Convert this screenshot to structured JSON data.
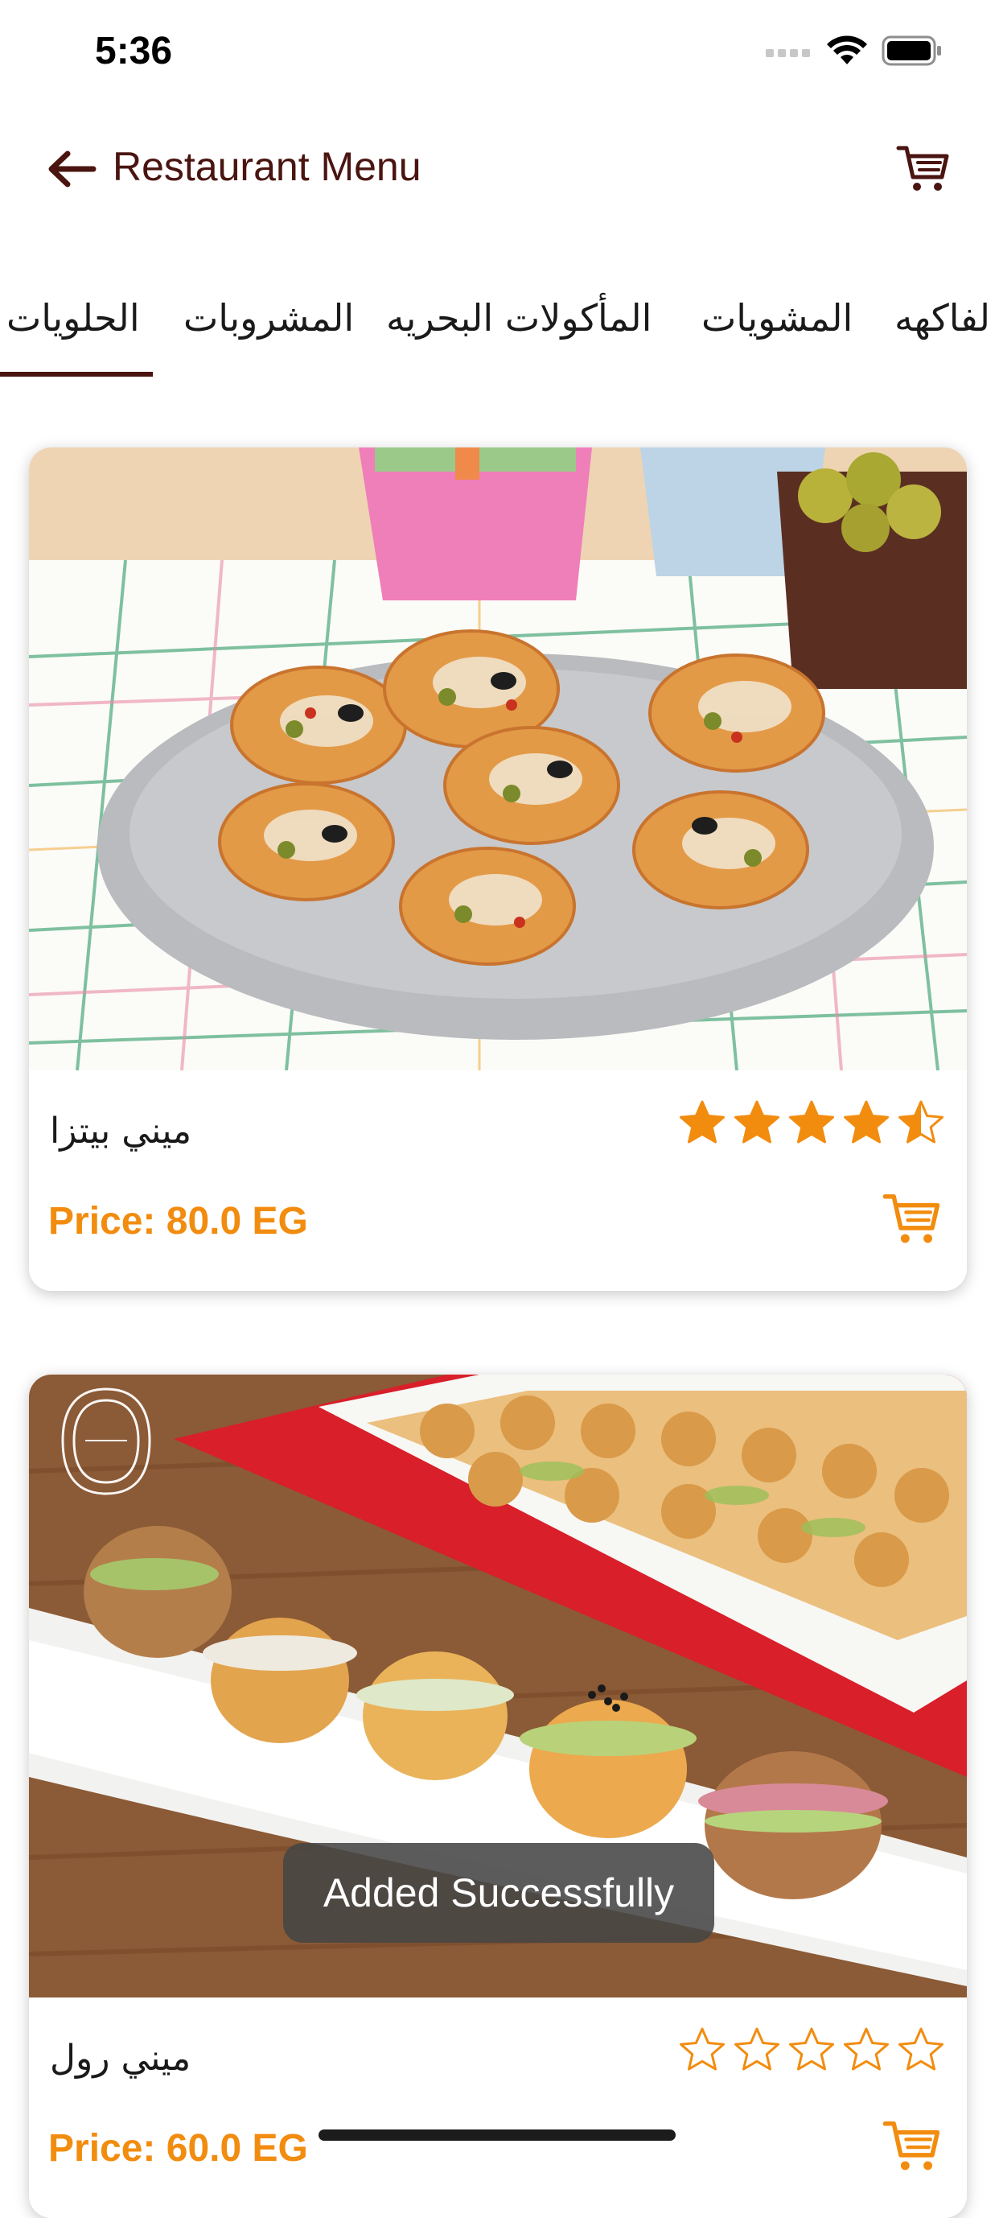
{
  "status_bar": {
    "time": "5:36"
  },
  "header": {
    "title": "Restaurant Menu"
  },
  "tabs": [
    {
      "label": "الحلويات",
      "selected": true
    },
    {
      "label": "المشروبات",
      "selected": false
    },
    {
      "label": "المأكولات البحريه",
      "selected": false
    },
    {
      "label": "المشويات",
      "selected": false
    },
    {
      "label": "لفاكهه",
      "selected": false
    }
  ],
  "items": [
    {
      "name": "ميني بيتزا",
      "price": "Price: 80.0 EG",
      "rating": 4.5
    },
    {
      "name": "ميني رول",
      "price": "Price: 60.0 EG",
      "rating": 0
    }
  ],
  "toast": {
    "text": "Added Successfully"
  },
  "colors": {
    "brand": "#4a1410",
    "accent": "#f28c0f",
    "toast_bg": "#464646"
  }
}
